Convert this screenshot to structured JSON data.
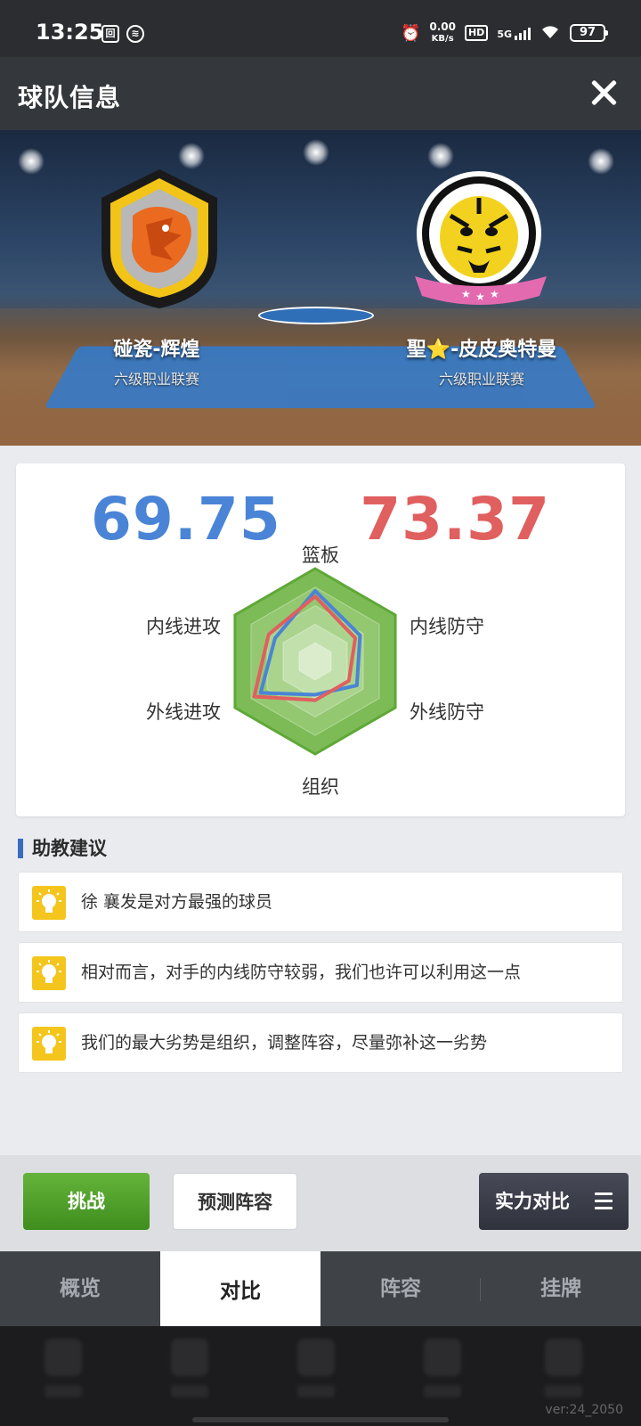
{
  "status_bar": {
    "time": "13:25",
    "net_speed": "0.00",
    "net_unit": "KB/s",
    "hd": "HD",
    "network": "5G",
    "battery": "97"
  },
  "header": {
    "title": "球队信息"
  },
  "teams": {
    "left": {
      "name": "碰瓷-辉煌",
      "league": "六级职业联赛",
      "logo": "dragon-logo"
    },
    "right": {
      "name": "聖⭐-皮皮奥特曼",
      "league": "六级职业联赛",
      "logo": "tiger-logo"
    }
  },
  "comparison": {
    "left_score": "69.75",
    "right_score": "73.37",
    "left_color": "#4a84d6",
    "right_color": "#e05f5f",
    "axes": {
      "top": "篮板",
      "upper_right": "内线防守",
      "lower_right": "外线防守",
      "bottom": "组织",
      "lower_left": "外线进攻",
      "upper_left": "内线进攻"
    }
  },
  "chart_data": {
    "type": "radar",
    "axes": [
      "篮板",
      "内线防守",
      "外线防守",
      "组织",
      "外线进攻",
      "内线进攻"
    ],
    "series": [
      {
        "values": [
          0.76,
          0.56,
          0.52,
          0.36,
          0.68,
          0.5
        ],
        "color": "#4a84d6"
      },
      {
        "values": [
          0.7,
          0.5,
          0.42,
          0.42,
          0.76,
          0.58
        ],
        "color": "#e05f5f"
      }
    ],
    "range": [
      0,
      1
    ]
  },
  "advice": {
    "title": "助教建议",
    "items": [
      "徐 襄发是对方最强的球员",
      "相对而言，对手的内线防守较弱，我们也许可以利用这一点",
      "我们的最大劣势是组织，调整阵容，尽量弥补这一劣势"
    ]
  },
  "actions": {
    "challenge": "挑战",
    "predict": "预测阵容",
    "strength": "实力对比"
  },
  "tabs": [
    "概览",
    "对比",
    "阵容",
    "挂牌"
  ],
  "active_tab": "对比",
  "version": "ver:24_2050"
}
